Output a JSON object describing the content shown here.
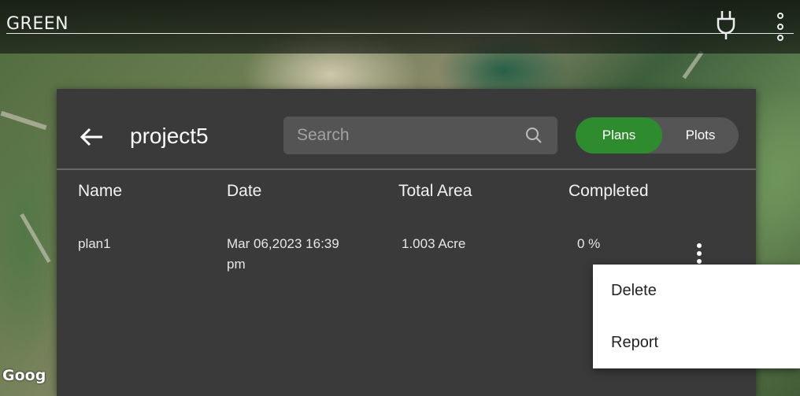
{
  "app": {
    "title": "GREEN"
  },
  "topbar": {
    "power_icon": "plug-icon",
    "menu_icon": "more-vert-icon"
  },
  "map": {
    "attribution": "Goog"
  },
  "dialog": {
    "back_icon": "arrow-left-icon",
    "title": "project5",
    "search": {
      "placeholder": "Search",
      "value": "",
      "icon": "search-icon"
    },
    "toggle": {
      "options": [
        "Plans",
        "Plots"
      ],
      "selected": "Plans",
      "active_color": "#2e8b2e"
    },
    "table": {
      "columns": [
        "Name",
        "Date",
        "Total Area",
        "Completed"
      ],
      "rows": [
        {
          "name": "plan1",
          "date": "Mar 06,2023 16:39",
          "date_suffix": "pm",
          "area": "1.003 Acre",
          "completed": "0 %"
        }
      ]
    }
  },
  "context_menu": {
    "items": [
      "Delete",
      "Report"
    ]
  }
}
